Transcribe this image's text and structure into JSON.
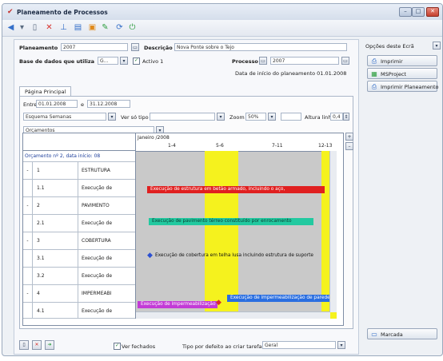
{
  "window": {
    "title": "Planeamento de Processos",
    "controls": [
      "minimize",
      "maximize",
      "close"
    ]
  },
  "toolbar": {
    "icons": [
      "back-arrow-icon",
      "new-document-icon",
      "delete-icon",
      "chart-icon",
      "table-icon",
      "folder-icon",
      "tools-icon",
      "refresh-icon",
      "exit-icon"
    ]
  },
  "header": {
    "planeamento_label": "Planeamento",
    "planeamento_value": "2007",
    "descricao_label": "Descrição",
    "descricao_value": "Nova Ponte sobre o Tejo",
    "base_dados_label": "Base de dados que utiliza",
    "base_dados_value": "G...",
    "activo_label": "Activo 1",
    "processo_label": "Processo",
    "processo_value": "2007",
    "data_inicio_text": "Data de início do planeamento 01.01.2008"
  },
  "tabs": [
    {
      "label": "Página Principal"
    }
  ],
  "filters": {
    "entre_label": "Entre",
    "entre_from": "01.01.2008",
    "e_label": "e",
    "entre_to": "31.12.2008",
    "esquema_label": "Esquema Semanas",
    "ver_so_label": "Ver só tipo",
    "zoom_label": "Zoom",
    "zoom_value": "50%",
    "altura_label": "Altura linha",
    "altura_value": "0,4",
    "orcamentos_label": "Orçamentos"
  },
  "grid": {
    "budget_header": "Orçamento nº 2, data início: 08",
    "month_label": "Janeiro /2008",
    "weeks": [
      "1-4",
      "5-6",
      "7-11",
      "12-13"
    ],
    "rows": [
      {
        "level": "-",
        "num": "1",
        "text": "ESTRUTURA"
      },
      {
        "level": "",
        "num": "1.1",
        "text": "Execução de"
      },
      {
        "level": "-",
        "num": "2",
        "text": "PAVIMENTO"
      },
      {
        "level": "",
        "num": "2.1",
        "text": "Execução de"
      },
      {
        "level": "-",
        "num": "3",
        "text": "COBERTURA"
      },
      {
        "level": "",
        "num": "3.1",
        "text": "Execução de"
      },
      {
        "level": "",
        "num": "3.2",
        "text": "Execução de"
      },
      {
        "level": "-",
        "num": "4",
        "text": "IMPERMEABI"
      },
      {
        "level": "",
        "num": "4.1",
        "text": "Execução de"
      }
    ],
    "bars": [
      {
        "label": "Execução de estrutura em betão armado, incluindo o aço,",
        "color": "#e02020"
      },
      {
        "label": "Execução de pavimento térreo constituído por enrocamento",
        "color": "#22c9a0"
      },
      {
        "label": "Execução de cobertura em telha lusa incluindo estrutura de suporte",
        "color": "#2b4fd1"
      },
      {
        "label": "Execução de impermeabilização",
        "color": "#c23bd6"
      },
      {
        "label": "Execução de impermeabilização de paredes",
        "color": "#2a6ee0"
      }
    ]
  },
  "footer": {
    "ver_fechados_label": "Ver fechados",
    "tipo_defeito_label": "Tipo por defeito ao criar tarefas:",
    "tipo_defeito_value": "Geral"
  },
  "side": {
    "title": "Opções deste Ecrã",
    "buttons": [
      {
        "label": "Imprimir",
        "icon": "printer-icon"
      },
      {
        "label": "MSProject",
        "icon": "project-icon"
      },
      {
        "label": "Imprimir Planeamento",
        "icon": "printer-icon"
      }
    ],
    "bottom_button": "Marcada"
  },
  "colors": {
    "accent": "#3670c9",
    "gantt_bg": "#c9c9c9",
    "gantt_highlight": "#f5f21e"
  }
}
